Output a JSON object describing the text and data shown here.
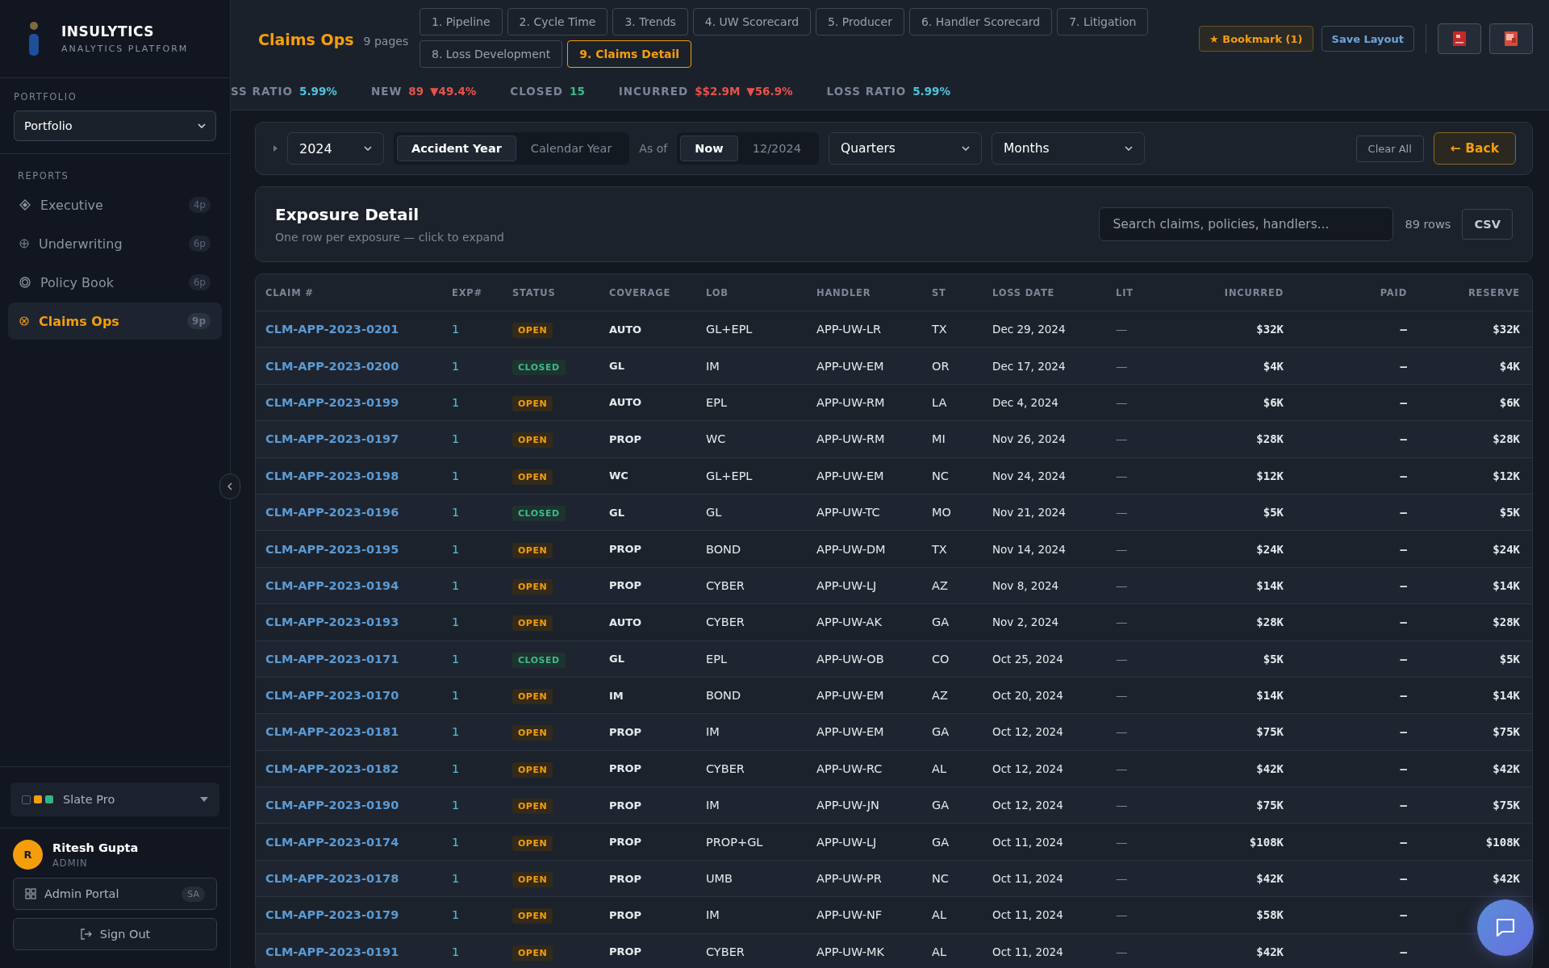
{
  "brand": {
    "name": "INSULYTICS",
    "tagline": "ANALYTICS PLATFORM"
  },
  "sidebar": {
    "portfolio_label": "PORTFOLIO",
    "portfolio_select": "Portfolio",
    "reports_label": "REPORTS",
    "items": [
      {
        "label": "Executive",
        "badge": "4p",
        "kind": "diamond",
        "selected": false
      },
      {
        "label": "Underwriting",
        "badge": "6p",
        "kind": "plus",
        "selected": false
      },
      {
        "label": "Policy Book",
        "badge": "6p",
        "kind": "ring",
        "selected": false
      },
      {
        "label": "Claims Ops",
        "badge": "9p",
        "kind": "cross",
        "selected": true
      }
    ],
    "theme": {
      "label": "Slate Pro",
      "swatches": [
        {
          "color": "#1c222d"
        },
        {
          "color": "#f59e0b"
        },
        {
          "color": "#34b38a"
        }
      ]
    },
    "user": {
      "initial": "R",
      "name": "Ritesh Gupta",
      "role": "ADMIN"
    },
    "admin_portal": {
      "label": "Admin Portal",
      "badge": "SA"
    },
    "sign_out": "Sign Out"
  },
  "header": {
    "title": "Claims Ops",
    "subtitle": "9 pages",
    "tabs": [
      {
        "label": "1. Pipeline",
        "selected": false
      },
      {
        "label": "2. Cycle Time",
        "selected": false
      },
      {
        "label": "3. Trends",
        "selected": false
      },
      {
        "label": "4. UW Scorecard",
        "selected": false
      },
      {
        "label": "5. Producer",
        "selected": false
      },
      {
        "label": "6. Handler Scorecard",
        "selected": false
      },
      {
        "label": "7. Litigation",
        "selected": false
      },
      {
        "label": "8. Loss Development",
        "selected": false
      },
      {
        "label": "9. Claims Detail",
        "selected": true
      }
    ],
    "bookmark": "★ Bookmark (1)",
    "save_layout": "Save Layout"
  },
  "ticker": [
    {
      "label": "SS RATIO",
      "value": "5.99%",
      "kind": "teal"
    },
    {
      "label": "NEW",
      "value": "89",
      "change": "▼49.4%",
      "kind": "red"
    },
    {
      "label": "CLOSED",
      "value": "15",
      "kind": "green"
    },
    {
      "label": "INCURRED",
      "value": "$$2.9M",
      "change": "▼56.9%",
      "kind": "red"
    },
    {
      "label": "LOSS RATIO",
      "value": "5.99%",
      "kind": "teal"
    }
  ],
  "filters": {
    "year": "2024",
    "year_basis": [
      {
        "label": "Accident Year",
        "selected": true
      },
      {
        "label": "Calendar Year",
        "selected": false
      }
    ],
    "as_of_label": "As of",
    "as_of": [
      {
        "label": "Now",
        "selected": true
      },
      {
        "label": "12/2024",
        "selected": false
      }
    ],
    "period": "Quarters",
    "subperiod": "Months",
    "clear": "Clear All",
    "back": "← Back"
  },
  "section": {
    "title": "Exposure Detail",
    "subtitle": "One row per exposure — click to expand",
    "search_placeholder": "Search claims, policies, handlers...",
    "row_count": "89 rows",
    "export": "CSV"
  },
  "table": {
    "columns": [
      "CLAIM #",
      "EXP#",
      "STATUS",
      "COVERAGE",
      "LOB",
      "HANDLER",
      "ST",
      "LOSS DATE",
      "LIT",
      "INCURRED",
      "PAID",
      "RESERVE"
    ],
    "rows": [
      {
        "claim": "CLM-APP-2023-0201",
        "exp": "1",
        "status": "OPEN",
        "closed": false,
        "coverage": "AUTO",
        "lob": "GL+EPL",
        "handler": "APP-UW-LR",
        "st": "TX",
        "loss_date": "Dec 29, 2024",
        "lit": "—",
        "incurred": "$32K",
        "paid": "–",
        "reserve": "$32K"
      },
      {
        "claim": "CLM-APP-2023-0200",
        "exp": "1",
        "status": "CLOSED",
        "closed": true,
        "coverage": "GL",
        "lob": "IM",
        "handler": "APP-UW-EM",
        "st": "OR",
        "loss_date": "Dec 17, 2024",
        "lit": "—",
        "incurred": "$4K",
        "paid": "–",
        "reserve": "$4K"
      },
      {
        "claim": "CLM-APP-2023-0199",
        "exp": "1",
        "status": "OPEN",
        "closed": false,
        "coverage": "AUTO",
        "lob": "EPL",
        "handler": "APP-UW-RM",
        "st": "LA",
        "loss_date": "Dec 4, 2024",
        "lit": "—",
        "incurred": "$6K",
        "paid": "–",
        "reserve": "$6K"
      },
      {
        "claim": "CLM-APP-2023-0197",
        "exp": "1",
        "status": "OPEN",
        "closed": false,
        "coverage": "PROP",
        "lob": "WC",
        "handler": "APP-UW-RM",
        "st": "MI",
        "loss_date": "Nov 26, 2024",
        "lit": "—",
        "incurred": "$28K",
        "paid": "–",
        "reserve": "$28K"
      },
      {
        "claim": "CLM-APP-2023-0198",
        "exp": "1",
        "status": "OPEN",
        "closed": false,
        "coverage": "WC",
        "lob": "GL+EPL",
        "handler": "APP-UW-EM",
        "st": "NC",
        "loss_date": "Nov 24, 2024",
        "lit": "—",
        "incurred": "$12K",
        "paid": "–",
        "reserve": "$12K"
      },
      {
        "claim": "CLM-APP-2023-0196",
        "exp": "1",
        "status": "CLOSED",
        "closed": true,
        "coverage": "GL",
        "lob": "GL",
        "handler": "APP-UW-TC",
        "st": "MO",
        "loss_date": "Nov 21, 2024",
        "lit": "—",
        "incurred": "$5K",
        "paid": "–",
        "reserve": "$5K"
      },
      {
        "claim": "CLM-APP-2023-0195",
        "exp": "1",
        "status": "OPEN",
        "closed": false,
        "coverage": "PROP",
        "lob": "BOND",
        "handler": "APP-UW-DM",
        "st": "TX",
        "loss_date": "Nov 14, 2024",
        "lit": "—",
        "incurred": "$24K",
        "paid": "–",
        "reserve": "$24K"
      },
      {
        "claim": "CLM-APP-2023-0194",
        "exp": "1",
        "status": "OPEN",
        "closed": false,
        "coverage": "PROP",
        "lob": "CYBER",
        "handler": "APP-UW-LJ",
        "st": "AZ",
        "loss_date": "Nov 8, 2024",
        "lit": "—",
        "incurred": "$14K",
        "paid": "–",
        "reserve": "$14K"
      },
      {
        "claim": "CLM-APP-2023-0193",
        "exp": "1",
        "status": "OPEN",
        "closed": false,
        "coverage": "AUTO",
        "lob": "CYBER",
        "handler": "APP-UW-AK",
        "st": "GA",
        "loss_date": "Nov 2, 2024",
        "lit": "—",
        "incurred": "$28K",
        "paid": "–",
        "reserve": "$28K"
      },
      {
        "claim": "CLM-APP-2023-0171",
        "exp": "1",
        "status": "CLOSED",
        "closed": true,
        "coverage": "GL",
        "lob": "EPL",
        "handler": "APP-UW-OB",
        "st": "CO",
        "loss_date": "Oct 25, 2024",
        "lit": "—",
        "incurred": "$5K",
        "paid": "–",
        "reserve": "$5K"
      },
      {
        "claim": "CLM-APP-2023-0170",
        "exp": "1",
        "status": "OPEN",
        "closed": false,
        "coverage": "IM",
        "lob": "BOND",
        "handler": "APP-UW-EM",
        "st": "AZ",
        "loss_date": "Oct 20, 2024",
        "lit": "—",
        "incurred": "$14K",
        "paid": "–",
        "reserve": "$14K"
      },
      {
        "claim": "CLM-APP-2023-0181",
        "exp": "1",
        "status": "OPEN",
        "closed": false,
        "coverage": "PROP",
        "lob": "IM",
        "handler": "APP-UW-EM",
        "st": "GA",
        "loss_date": "Oct 12, 2024",
        "lit": "—",
        "incurred": "$75K",
        "paid": "–",
        "reserve": "$75K"
      },
      {
        "claim": "CLM-APP-2023-0182",
        "exp": "1",
        "status": "OPEN",
        "closed": false,
        "coverage": "PROP",
        "lob": "CYBER",
        "handler": "APP-UW-RC",
        "st": "AL",
        "loss_date": "Oct 12, 2024",
        "lit": "—",
        "incurred": "$42K",
        "paid": "–",
        "reserve": "$42K"
      },
      {
        "claim": "CLM-APP-2023-0190",
        "exp": "1",
        "status": "OPEN",
        "closed": false,
        "coverage": "PROP",
        "lob": "IM",
        "handler": "APP-UW-JN",
        "st": "GA",
        "loss_date": "Oct 12, 2024",
        "lit": "—",
        "incurred": "$75K",
        "paid": "–",
        "reserve": "$75K"
      },
      {
        "claim": "CLM-APP-2023-0174",
        "exp": "1",
        "status": "OPEN",
        "closed": false,
        "coverage": "PROP",
        "lob": "PROP+GL",
        "handler": "APP-UW-LJ",
        "st": "GA",
        "loss_date": "Oct 11, 2024",
        "lit": "—",
        "incurred": "$108K",
        "paid": "–",
        "reserve": "$108K"
      },
      {
        "claim": "CLM-APP-2023-0178",
        "exp": "1",
        "status": "OPEN",
        "closed": false,
        "coverage": "PROP",
        "lob": "UMB",
        "handler": "APP-UW-PR",
        "st": "NC",
        "loss_date": "Oct 11, 2024",
        "lit": "—",
        "incurred": "$42K",
        "paid": "–",
        "reserve": "$42K"
      },
      {
        "claim": "CLM-APP-2023-0179",
        "exp": "1",
        "status": "OPEN",
        "closed": false,
        "coverage": "PROP",
        "lob": "IM",
        "handler": "APP-UW-NF",
        "st": "AL",
        "loss_date": "Oct 11, 2024",
        "lit": "—",
        "incurred": "$58K",
        "paid": "–"
      },
      {
        "claim": "CLM-APP-2023-0191",
        "exp": "1",
        "status": "OPEN",
        "closed": false,
        "coverage": "PROP",
        "lob": "CYBER",
        "handler": "APP-UW-MK",
        "st": "AL",
        "loss_date": "Oct 11, 2024",
        "lit": "—",
        "incurred": "$42K",
        "paid": "–"
      }
    ]
  }
}
